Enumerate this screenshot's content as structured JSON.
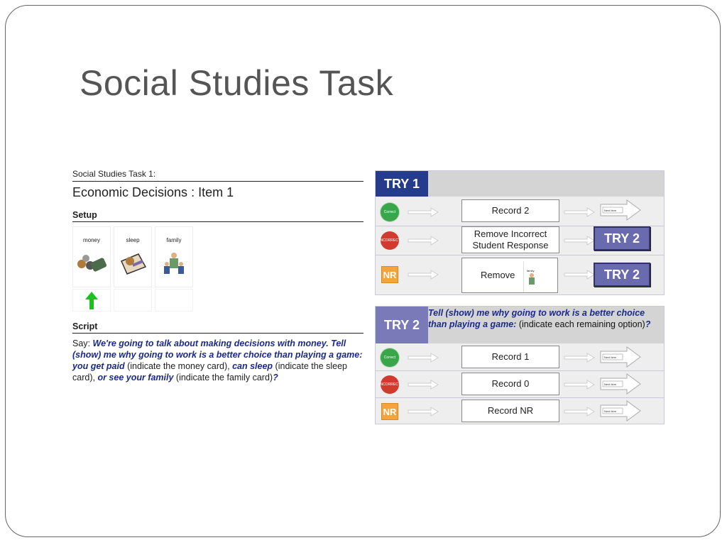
{
  "slide": {
    "title": "Social Studies Task"
  },
  "left": {
    "task_label": "Social Studies Task 1:",
    "item_title": "Economic Decisions : Item 1",
    "setup_head": "Setup",
    "cards": [
      {
        "label": "money"
      },
      {
        "label": "sleep"
      },
      {
        "label": "family"
      }
    ],
    "script_head": "Script",
    "script": {
      "say": "Say: ",
      "s1": "We're going to talk about making decisions with money. Tell (show) me why going to work is a better choice than playing a game: you get paid",
      "n1": " (indicate the money card), ",
      "s2": "can sleep",
      "n2": " (indicate the sleep card), ",
      "s3": "or see your family",
      "n3": " (indicate the family card)",
      "s4": "?"
    }
  },
  "try1": {
    "badge": "TRY 1",
    "rows": [
      {
        "icon": "correct",
        "icon_text": "Correct",
        "box": "Record 2",
        "action": "next",
        "next_text": "Next Item"
      },
      {
        "icon": "incorrect",
        "icon_text": "INCORRECT",
        "box": "Remove Incorrect Student Response",
        "action": "try2",
        "try2": "TRY 2"
      },
      {
        "icon": "nr",
        "icon_text": "NR",
        "box": "Remove",
        "mini_card_label": "family",
        "action": "try2",
        "try2": "TRY 2"
      }
    ]
  },
  "try2": {
    "badge": "TRY 2",
    "prompt_bold": "Tell (show) me why going to work is a better choice than playing a game:",
    "prompt_plain": " (indicate each remaining option)",
    "prompt_end": "?",
    "rows": [
      {
        "icon": "correct",
        "icon_text": "Correct",
        "box": "Record 1",
        "next_text": "Next Item"
      },
      {
        "icon": "incorrect",
        "icon_text": "INCORRECT",
        "box": "Record 0",
        "next_text": "Next Item"
      },
      {
        "icon": "nr",
        "icon_text": "NR",
        "box": "Record NR",
        "next_text": "Next Item"
      }
    ]
  },
  "colors": {
    "try1_badge": "#253c8c",
    "try2_badge": "#7a7ab8",
    "correct": "#3aa64a",
    "incorrect": "#d23a2e",
    "nr": "#f5a43b",
    "script_emphasis": "#1a2a8a"
  },
  "icons": [
    "correct-icon",
    "incorrect-icon",
    "nr-icon",
    "up-arrow-icon",
    "next-item-arrow-icon",
    "right-arrow-icon"
  ]
}
